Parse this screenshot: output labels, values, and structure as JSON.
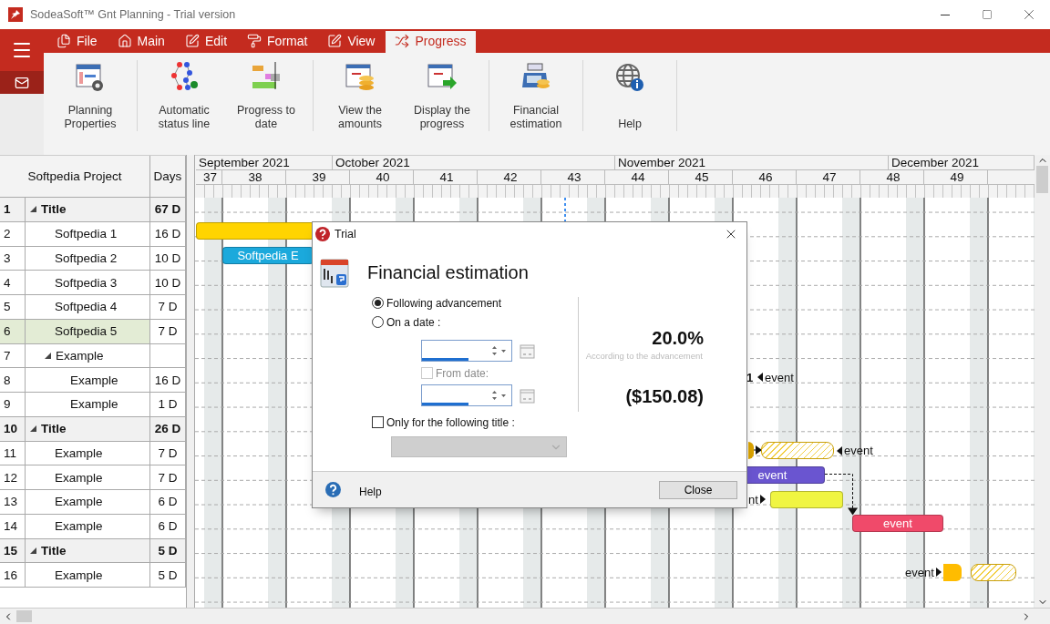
{
  "window": {
    "title": "SodeaSoft™ Gnt Planning - Trial version"
  },
  "ribbon": {
    "tabs": [
      {
        "label": "File",
        "selected": false
      },
      {
        "label": "Main",
        "selected": false
      },
      {
        "label": "Edit",
        "selected": false
      },
      {
        "label": "Format",
        "selected": false
      },
      {
        "label": "View",
        "selected": false
      },
      {
        "label": "Progress",
        "selected": true
      }
    ],
    "groups": [
      {
        "buttons": [
          {
            "label": "Planning Properties"
          }
        ]
      },
      {
        "buttons": [
          {
            "label": "Automatic status line"
          },
          {
            "label": "Progress to date"
          }
        ]
      },
      {
        "buttons": [
          {
            "label": "View the amounts"
          },
          {
            "label": "Display the progress"
          }
        ]
      },
      {
        "buttons": [
          {
            "label": "Financial estimation"
          }
        ]
      },
      {
        "buttons": [
          {
            "label": "Help"
          }
        ]
      }
    ]
  },
  "table": {
    "columns": [
      "Softpedia Project",
      "Days"
    ],
    "rows": [
      {
        "num": "1",
        "name": "Title",
        "days": "67 D",
        "kind": "title",
        "expanded": true,
        "selected": false,
        "children": [
          {
            "num": "2",
            "name": "Softpedia 1",
            "days": "16 D",
            "kind": "task",
            "selected": false
          },
          {
            "num": "3",
            "name": "Softpedia 2",
            "days": "10 D",
            "kind": "task",
            "selected": false
          },
          {
            "num": "4",
            "name": "Softpedia 3",
            "days": "10 D",
            "kind": "task",
            "selected": false
          },
          {
            "num": "5",
            "name": "Softpedia 4",
            "days": "7 D",
            "kind": "task",
            "selected": false
          },
          {
            "num": "6",
            "name": "Softpedia 5",
            "days": "7 D",
            "kind": "task",
            "selected": true
          },
          {
            "num": "7",
            "name": "Example",
            "kind": "task",
            "expanded": true,
            "selected": false,
            "children": [
              {
                "num": "8",
                "name": "Example",
                "days": "16 D",
                "kind": "task",
                "selected": false
              },
              {
                "num": "9",
                "name": "Example",
                "days": "1 D",
                "kind": "task",
                "selected": false
              }
            ]
          }
        ]
      },
      {
        "num": "10",
        "name": "Title",
        "days": "26 D",
        "kind": "title",
        "expanded": true,
        "selected": false,
        "children": [
          {
            "num": "11",
            "name": "Example",
            "days": "7 D",
            "kind": "task",
            "selected": false
          },
          {
            "num": "12",
            "name": "Example",
            "days": "7 D",
            "kind": "task",
            "selected": false
          },
          {
            "num": "13",
            "name": "Example",
            "days": "6 D",
            "kind": "task",
            "selected": false
          },
          {
            "num": "14",
            "name": "Example",
            "days": "6 D",
            "kind": "task",
            "selected": false
          }
        ]
      },
      {
        "num": "15",
        "name": "Title",
        "days": "5 D",
        "kind": "title",
        "expanded": true,
        "selected": false,
        "children": [
          {
            "num": "16",
            "name": "Example",
            "days": "5 D",
            "kind": "task",
            "selected": false
          }
        ]
      }
    ]
  },
  "gantt": {
    "months": [
      "September 2021",
      "October 2021",
      "November 2021",
      "December 2021"
    ],
    "weeks": [
      "37",
      "38",
      "39",
      "40",
      "41",
      "42",
      "43",
      "44",
      "45",
      "46",
      "47",
      "48",
      "49"
    ],
    "items": [
      {
        "kind": "bar",
        "color": "#ffd400"
      },
      {
        "kind": "bar",
        "color": "#1ba9dc",
        "label": "Softpedia E"
      },
      {
        "kind": "note",
        "label": "1",
        "bold": true
      },
      {
        "kind": "left-note",
        "label": "event"
      },
      {
        "kind": "milestone",
        "color": "#d9a200"
      },
      {
        "kind": "hatched",
        "color": "#c9a00c"
      },
      {
        "kind": "left-note",
        "label": "event"
      },
      {
        "kind": "bar",
        "color": "#6a55d0",
        "label": "event"
      },
      {
        "kind": "right-note",
        "label": "nt"
      },
      {
        "kind": "bar",
        "color": "#f0f542"
      },
      {
        "kind": "bar",
        "color": "#f04a6a",
        "label": "event"
      },
      {
        "kind": "right-note",
        "label": "event"
      },
      {
        "kind": "milestone",
        "color": "#ffbc00"
      },
      {
        "kind": "hatched",
        "color": "#c9a00c"
      }
    ]
  },
  "dialog": {
    "title": "Trial",
    "heading": "Financial estimation",
    "options": [
      {
        "label": "Following advancement",
        "selected": true
      },
      {
        "label": "On a date :",
        "selected": false
      }
    ],
    "from_date": {
      "label": "From date:",
      "checked": false,
      "disabled": true
    },
    "title_filter": {
      "label": "Only for the following title :",
      "checked": false
    },
    "title_select": {
      "disabled": true
    },
    "percent": "20.0%",
    "percent_caption": "According to the advancement",
    "amount": "($150.08)",
    "help": "Help",
    "close": "Close"
  }
}
